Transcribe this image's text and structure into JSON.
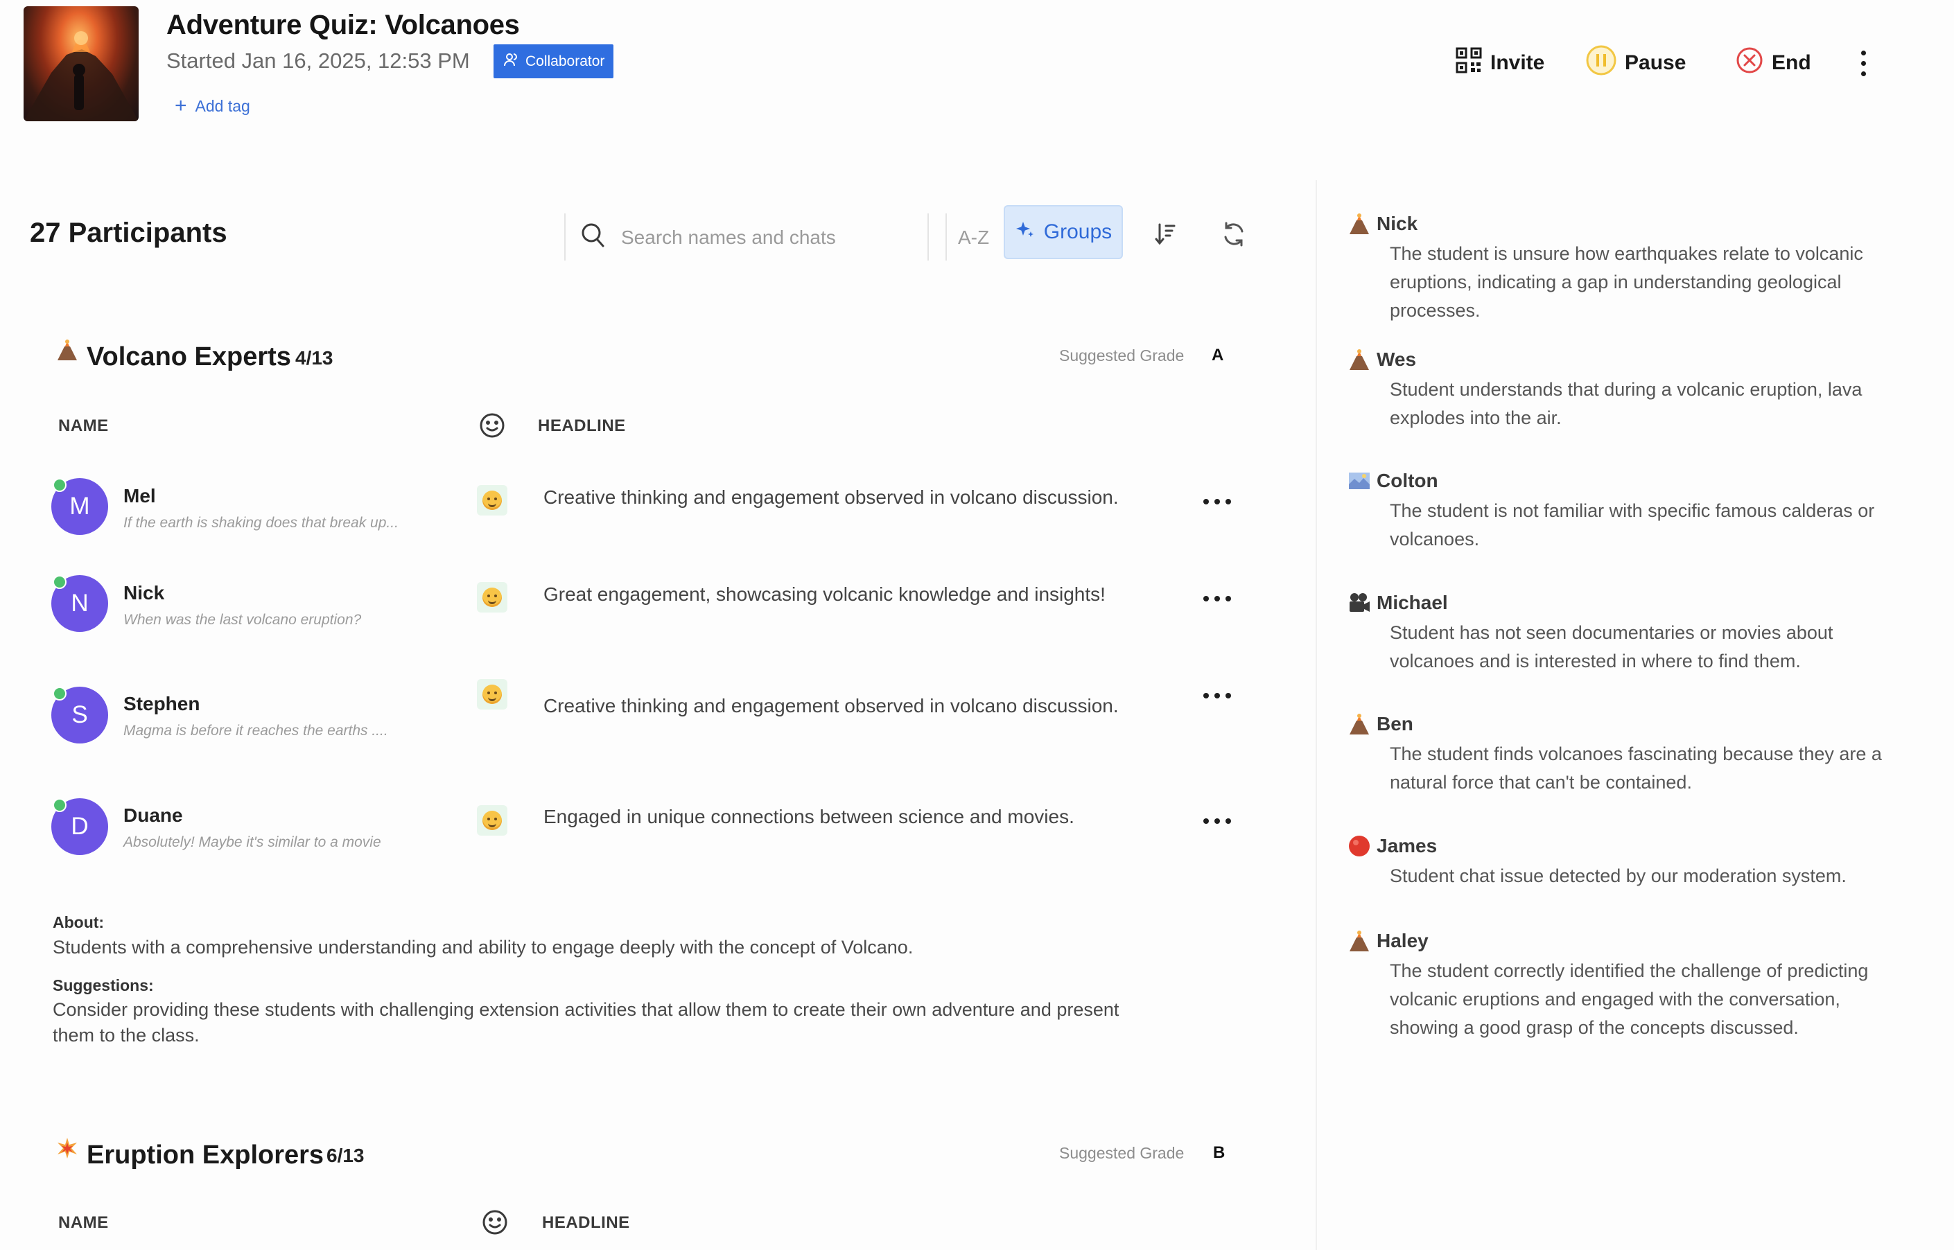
{
  "header": {
    "title": "Adventure Quiz: Volcanoes",
    "started": "Started Jan 16, 2025, 12:53 PM",
    "badge": "Collaborator",
    "add_tag": "Add tag",
    "actions": {
      "invite": "Invite",
      "pause": "Pause",
      "end": "End"
    }
  },
  "toolbar": {
    "participants": "27 Participants",
    "search_placeholder": "Search names and chats",
    "az": "A-Z",
    "groups": "Groups"
  },
  "groups": [
    {
      "name": "Volcano Experts",
      "count": "4/13",
      "suggested_label": "Suggested Grade",
      "grade": "A",
      "col_name": "NAME",
      "col_headline": "HEADLINE",
      "students": [
        {
          "initial": "M",
          "name": "Mel",
          "chat": "If the earth is shaking does that break up...",
          "headline": "Creative thinking and engagement observed in volcano discussion."
        },
        {
          "initial": "N",
          "name": "Nick",
          "chat": "When was the last volcano eruption?",
          "headline": "Great engagement, showcasing volcanic knowledge and insights!"
        },
        {
          "initial": "S",
          "name": "Stephen",
          "chat": "Magma is before it reaches the earths ....",
          "headline": "Creative thinking and engagement observed in volcano discussion."
        },
        {
          "initial": "D",
          "name": "Duane",
          "chat": "Absolutely! Maybe it's similar to a movie",
          "headline": "Engaged in unique connections between science and movies."
        }
      ],
      "about_label": "About:",
      "about_text": "Students with a comprehensive understanding and ability to engage deeply with the concept of Volcano.",
      "suggestions_label": "Suggestions:",
      "suggestions_text": "Consider providing these students with challenging extension activities that allow them to create their own adventure and present them to the class."
    },
    {
      "name": "Eruption Explorers",
      "count": "6/13",
      "suggested_label": "Suggested Grade",
      "grade": "B",
      "col_name": "NAME",
      "col_headline": "HEADLINE"
    }
  ],
  "insights": [
    {
      "name": "Nick",
      "icon": "volcano-icon",
      "text": "The student is unsure how earthquakes relate to volcanic eruptions, indicating a gap in understanding geological processes."
    },
    {
      "name": "Wes",
      "icon": "volcano-icon",
      "text": "Student understands that during a volcanic eruption, lava explodes into the air."
    },
    {
      "name": "Colton",
      "icon": "map-icon",
      "text": "The student is not familiar with specific famous calderas or volcanoes."
    },
    {
      "name": "Michael",
      "icon": "film-camera-icon",
      "text": "Student has not seen documentaries or movies about volcanoes and is interested in where to find them."
    },
    {
      "name": "Ben",
      "icon": "volcano-icon",
      "text": "The student finds volcanoes fascinating because they are a natural force that can't be contained."
    },
    {
      "name": "James",
      "icon": "red-circle-icon",
      "text": "Student chat issue detected by our moderation system."
    },
    {
      "name": "Haley",
      "icon": "volcano-icon",
      "text": "The student correctly identified the challenge of predicting volcanic eruptions and engaged with the conversation, showing a good grasp of the concepts discussed."
    }
  ],
  "colors": {
    "accent": "#2f6ee0",
    "avatar": "#6c54e4",
    "online": "#4cc16d",
    "end": "#e24848",
    "pause": "#f2c744",
    "groups_bg": "#dbe9fb"
  }
}
